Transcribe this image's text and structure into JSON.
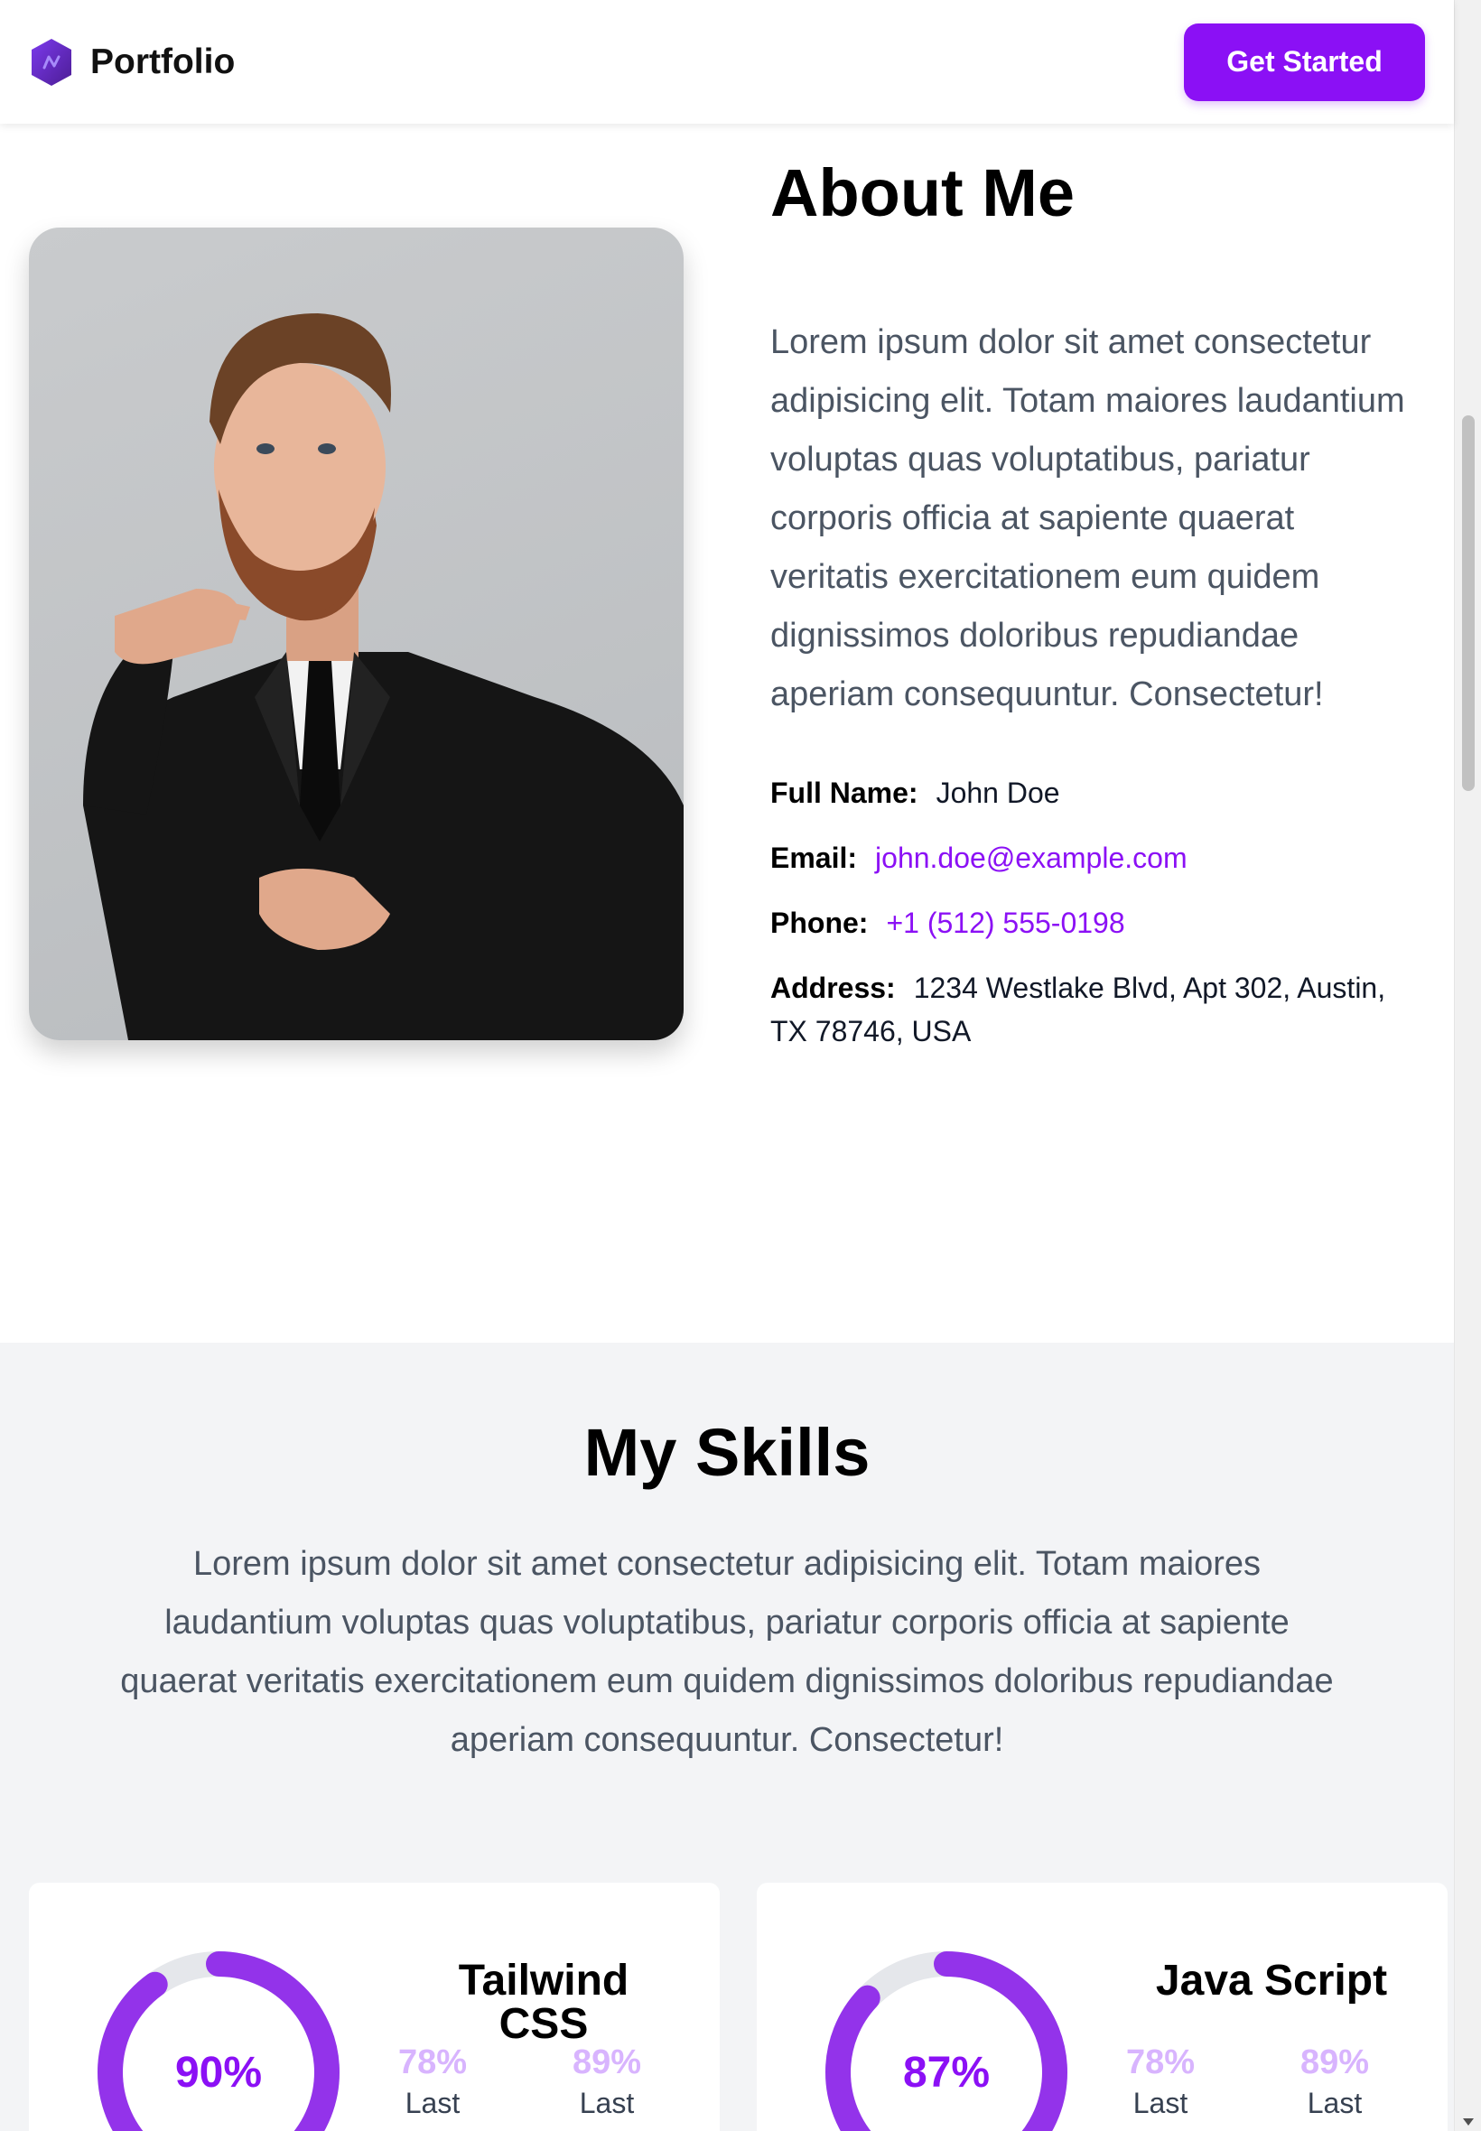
{
  "header": {
    "brand": "Portfolio",
    "cta": "Get Started",
    "accent": "#8b10f5"
  },
  "about": {
    "title": "About Me",
    "text": "Lorem ipsum dolor sit amet consectetur adipisicing elit. Totam maiores laudantium voluptas quas voluptatibus, pariatur corporis officia at sapiente quaerat veritatis exercitationem eum quidem dignissimos doloribus repudiandae aperiam consequuntur. Consectetur!",
    "info": {
      "full_name_label": "Full Name:",
      "full_name": "John Doe",
      "email_label": "Email:",
      "email": "john.doe@example.com",
      "phone_label": "Phone:",
      "phone": "+1 (512) 555-0198",
      "address_label": "Address:",
      "address": "1234 Westlake Blvd, Apt 302, Austin, TX 78746, USA"
    }
  },
  "skills": {
    "title": "My Skills",
    "text": "Lorem ipsum dolor sit amet consectetur adipisicing elit. Totam maiores laudantium voluptas quas voluptatibus, pariatur corporis officia at sapiente quaerat veritatis exercitationem eum quidem dignissimos doloribus repudiandae aperiam consequuntur. Consectetur!",
    "cards": [
      {
        "name": "Tailwind CSS",
        "percent": 90,
        "percent_label": "90%",
        "stat1": "78%",
        "stat1_caption": "Last",
        "stat2": "89%",
        "stat2_caption": "Last"
      },
      {
        "name": "Java Script",
        "percent": 87,
        "percent_label": "87%",
        "stat1": "78%",
        "stat1_caption": "Last",
        "stat2": "89%",
        "stat2_caption": "Last"
      }
    ]
  }
}
